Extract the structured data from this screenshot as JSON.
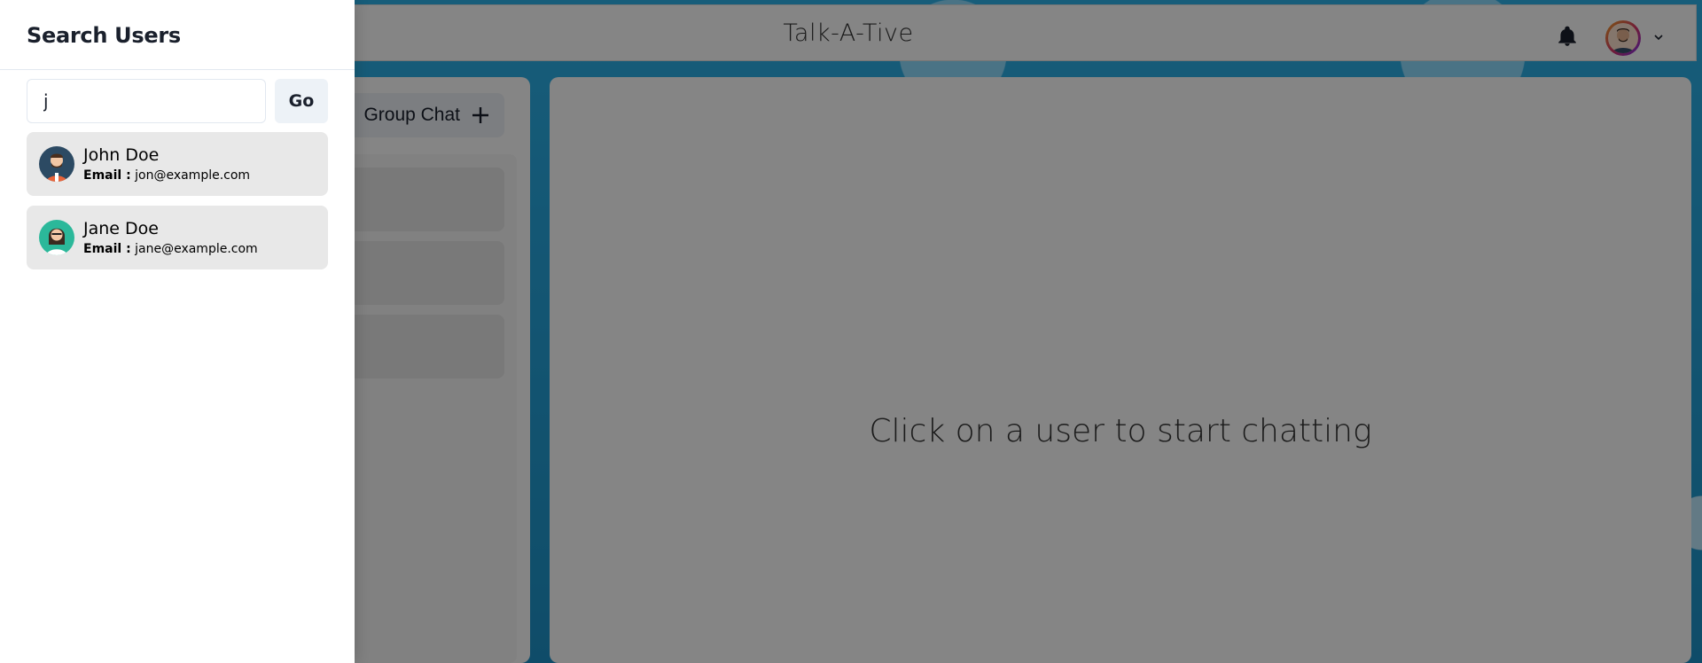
{
  "header": {
    "app_title": "Talk-A-Tive"
  },
  "icons": {
    "bell": "bell-icon",
    "chevron": "chevron-down-icon",
    "plus": "plus-icon"
  },
  "sidebar": {
    "new_group_label": "Group Chat"
  },
  "chat": {
    "placeholder": "Click on a user to start chatting"
  },
  "drawer": {
    "title": "Search Users",
    "search_value": "j",
    "go_label": "Go",
    "email_label": "Email :",
    "results": [
      {
        "name": "John Doe",
        "email": "jon@example.com",
        "avatar_color": "#2c4a63"
      },
      {
        "name": "Jane Doe",
        "email": "jane@example.com",
        "avatar_color": "#2bb89a"
      }
    ]
  },
  "colors": {
    "accent": "#2aa3d8",
    "overlay": "rgba(0,0,0,0.48)"
  }
}
